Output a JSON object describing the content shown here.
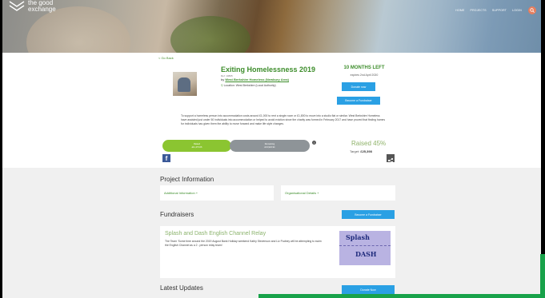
{
  "brand": {
    "line1": "the good",
    "line2": "exchange"
  },
  "nav": [
    "HOME",
    "PROJECTS",
    "SUPPORT",
    "LOGIN"
  ],
  "back_label": "< Go Back",
  "project": {
    "title": "Exiting Homelessness 2019",
    "ref": "Ref: 10805",
    "by_prefix": "by",
    "organisation": "West Berkshire Homeless (Newbury Area)",
    "location": "Location: West Berkshire (Local Authority)",
    "months_left": "10 MONTHS LEFT",
    "expires": "expires 2nd April 2020",
    "donate_label": "Donate now",
    "fundraiser_label": "Become a Fundraiser",
    "description": "To support a homeless person into accommodation costs around £1,000 to rent a single room or £1,800 to move into a studio flat or similar. West Berkshire Homeless have assisted just under 50 individuals into accommodation or helped to avoid eviction since the charity was formed in February 2017 and have proved that finding homes for individuals has given them the ability to move forward and make life style changes.",
    "raised_label": "Raised",
    "raised_amount": "£11,473.06",
    "remaining_label": "Remaining",
    "remaining_amount": "£13,924.94",
    "raised_percent_text": "Raised 45%",
    "target_label": "Target:",
    "target_value": "£25,398",
    "raised_fraction": 0.45
  },
  "sections": {
    "project_info": "Project Information",
    "additional": "Additional Information +",
    "organisational": "Organisational Details +",
    "fundraisers": "Fundraisers",
    "become_fundraiser": "Become a Fundraiser",
    "latest_updates": "Latest Updates",
    "donate_now": "Donate Now"
  },
  "fundraiser": {
    "title": "Splash and Dash English Channel Relay",
    "text": "The Team 'Some time around the 2019 August Bank Holiday weekend Kathy Stevenson and Liz Pudney will be attempting to swim the English Channel as a 2 - person relay team!",
    "image_line1": "Splash",
    "image_line2": "DASH"
  },
  "colors": {
    "brand_green": "#3d8d2b",
    "button_blue": "#2aa0e4",
    "progress_green": "#8bc531",
    "progress_grey": "#8e9498",
    "accent_green": "#18a24a"
  }
}
